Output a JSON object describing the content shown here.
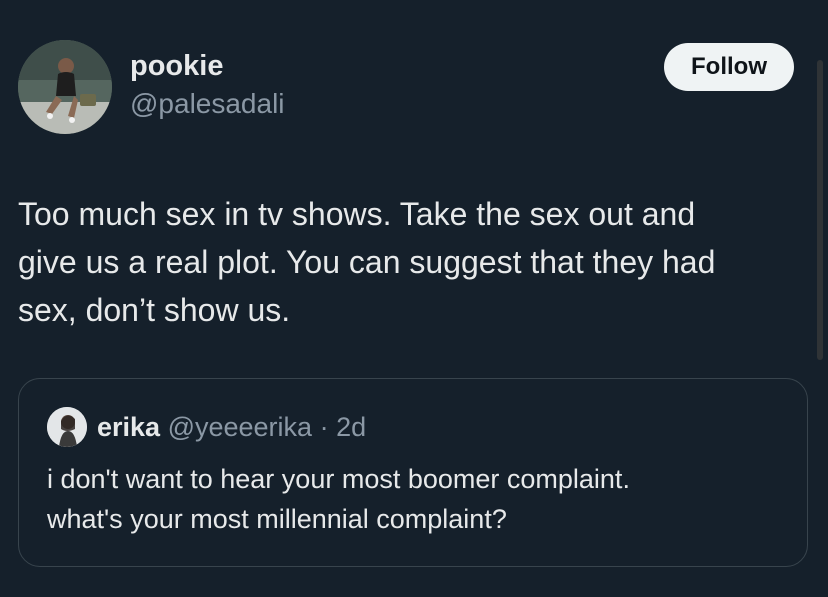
{
  "author": {
    "display_name": "pookie",
    "handle": "@palesadali"
  },
  "follow_button": {
    "label": "Follow"
  },
  "tweet": {
    "text": "Too much sex in tv shows. Take the sex out and\ngive us a real plot. You can suggest that they had\nsex, don’t show us."
  },
  "quoted_tweet": {
    "display_name": "erika",
    "handle": "@yeeeerika",
    "separator": " · ",
    "time": "2d",
    "text": "i don't want to hear your most boomer complaint.\nwhat's your most millennial complaint?"
  },
  "colors": {
    "background": "#15202b",
    "text_primary": "#e7e9ea",
    "text_secondary": "#8b98a5",
    "border": "#38444d",
    "follow_bg": "#eff3f4"
  }
}
